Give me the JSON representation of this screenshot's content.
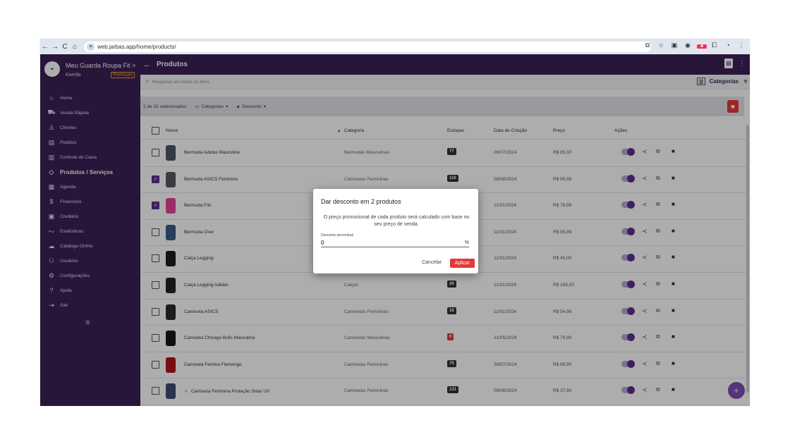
{
  "browser": {
    "url": "web.jarbas.app/home/products/",
    "nav": [
      "←",
      "→",
      "C",
      "⌂"
    ]
  },
  "app": {
    "store_name": "Meu Guarda Roupa Fit",
    "store_chevron": ">",
    "user_name": "Kamila",
    "plan": "Premium",
    "page_title": "Produtos"
  },
  "sidebar": {
    "items": [
      {
        "label": "Home",
        "icon": "home-icon"
      },
      {
        "label": "Venda Rápida",
        "icon": "cart-icon"
      },
      {
        "label": "Clientes",
        "icon": "user-icon"
      },
      {
        "label": "Pedidos",
        "icon": "orders-icon"
      },
      {
        "label": "Controle de Caixa",
        "icon": "cashier-icon"
      },
      {
        "label": "Produtos / Serviços",
        "icon": "tag-icon"
      },
      {
        "label": "Agenda",
        "icon": "calendar-icon"
      },
      {
        "label": "Financeiro",
        "icon": "dollar-icon"
      },
      {
        "label": "Crediário",
        "icon": "credit-icon"
      },
      {
        "label": "Estatísticas",
        "icon": "chart-icon"
      },
      {
        "label": "Catálogo Online",
        "icon": "cloud-icon"
      },
      {
        "label": "Usuários",
        "icon": "users-icon"
      },
      {
        "label": "Configurações",
        "icon": "gear-icon"
      },
      {
        "label": "Ajuda",
        "icon": "help-icon"
      },
      {
        "label": "Sair",
        "icon": "logout-icon"
      }
    ]
  },
  "search": {
    "placeholder": "Pesquisar em todos os itens",
    "categories_label": "Categorias"
  },
  "toolbar": {
    "selection": "2 de 32 selecionados",
    "categories": "Categorias",
    "discount": "Desconto"
  },
  "table": {
    "headers": {
      "name": "Nome",
      "category": "Categoria",
      "stock": "Estoque",
      "created": "Data de Criação",
      "price": "Preço",
      "actions": "Ações"
    },
    "rows": [
      {
        "name": "Bermuda Adidas Masculina",
        "category": "Bermudas Masculinas",
        "stock": "77",
        "date": "29/07/2024",
        "price": "R$ 85,90",
        "checked": false,
        "color": "#4d5566"
      },
      {
        "name": "Bermuda ASICS Feminina",
        "category": "Camisetas Femininas",
        "stock": "116",
        "date": "08/08/2024",
        "price": "R$ 85,99",
        "checked": true,
        "color": "#555a60"
      },
      {
        "name": "Bermuda Filo",
        "category": "",
        "stock": "",
        "date": "11/01/2024",
        "price": "R$ 78,99",
        "checked": true,
        "color": "#e5459a"
      },
      {
        "name": "Bermuda Oxer",
        "category": "",
        "stock": "",
        "date": "11/01/2024",
        "price": "R$ 95,99",
        "checked": false,
        "color": "#3a5a8a"
      },
      {
        "name": "Calça Legging",
        "category": "",
        "stock": "",
        "date": "11/01/2024",
        "price": "R$ 45,00",
        "checked": false,
        "color": "#1c1c1c"
      },
      {
        "name": "Calça Legging Adidas",
        "category": "Calças",
        "stock": "26",
        "date": "11/01/2024",
        "price": "R$ 165,00",
        "checked": false,
        "color": "#222222"
      },
      {
        "name": "Camiseta ASICS",
        "category": "Camisetas Femininas",
        "stock": "18",
        "date": "11/01/2024",
        "price": "R$ 54,99",
        "checked": false,
        "color": "#2a2a2a"
      },
      {
        "name": "Camiseta Chicago Bulls Masculina",
        "category": "Camisetas Masculinas",
        "stock": "0",
        "date": "21/05/2024",
        "price": "R$ 79,99",
        "checked": false,
        "color": "#151515"
      },
      {
        "name": "Camiseta Femina Flamengo",
        "category": "Camisetas Femininas",
        "stock": "75",
        "date": "29/07/2024",
        "price": "R$ 99,90",
        "checked": false,
        "color": "#b3121b"
      },
      {
        "name": "Camiseta Feminina Proteção Solar UV",
        "category": "Camisetas Femininas",
        "stock": "131",
        "date": "08/08/2024",
        "price": "R$ 37,90",
        "checked": false,
        "color": "#3e4c73",
        "star": true
      }
    ]
  },
  "dialog": {
    "title": "Dar desconto em 2 produtos",
    "body": "O preço promocional de cada produto será calculado com base no seu preço de venda.",
    "field_label": "Desconto percentual",
    "field_value": "0",
    "suffix": "%",
    "cancel": "Cancelar",
    "apply": "Aplicar"
  },
  "colors": {
    "brand": "#3b1f56",
    "danger": "#e53935",
    "accent": "#7b4fb3"
  }
}
